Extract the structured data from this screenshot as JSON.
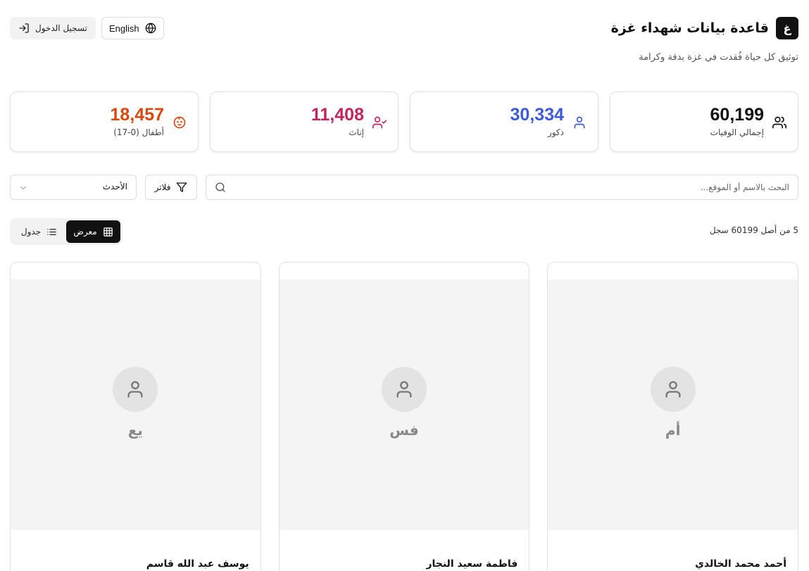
{
  "header": {
    "logo_letter": "غ",
    "title": "قاعدة بيانات شهداء غزة",
    "subtitle": "توثيق كل حياة فُقدت في غزة بدقة وكرامة",
    "language_label": "English",
    "login_label": "تسجيل الدخول"
  },
  "stats": [
    {
      "value": "60,199",
      "label": "إجمالي الوفيات",
      "color": "#111111",
      "icon": "users-icon"
    },
    {
      "value": "30,334",
      "label": "ذكور",
      "color": "#3b5bdb",
      "icon": "user-icon"
    },
    {
      "value": "11,408",
      "label": "إناث",
      "color": "#c2255c",
      "icon": "user-check-icon"
    },
    {
      "value": "18,457",
      "label": "أطفال (0-17)",
      "color": "#d9480f",
      "icon": "baby-icon"
    }
  ],
  "controls": {
    "search_placeholder": "البحث بالاسم أو الموقع...",
    "filter_label": "فلاتر",
    "sort_label": "الأحدث"
  },
  "results": {
    "count_text": "5 من أصل 60199 سجل"
  },
  "view_toggle": {
    "gallery_label": "معرض",
    "table_label": "جدول",
    "active": "gallery"
  },
  "cards": [
    {
      "initials": "أم",
      "name": "أحمد محمد الخالدي"
    },
    {
      "initials": "فس",
      "name": "فاطمة سعيد النجار"
    },
    {
      "initials": "يع",
      "name": "يوسف عبد الله قاسم"
    }
  ]
}
